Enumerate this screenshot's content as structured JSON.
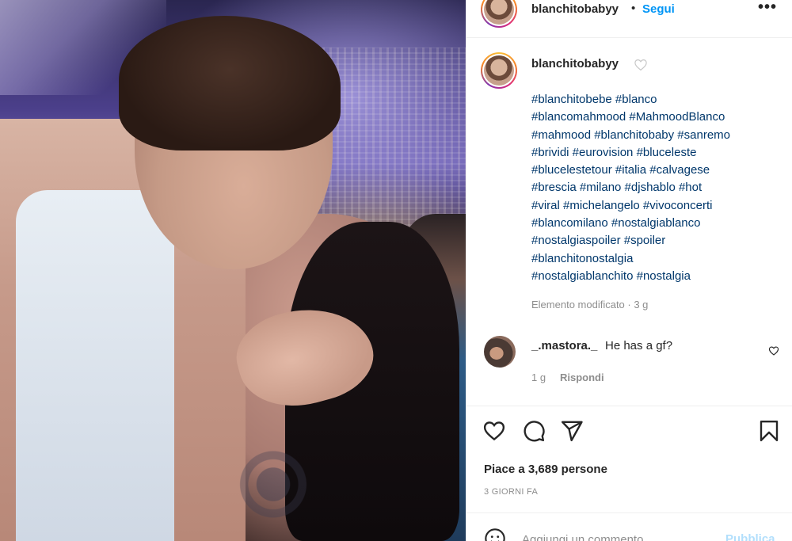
{
  "post": {
    "username": "blanchitobabyy",
    "separator": "•",
    "follow_label": "Segui",
    "more_icon": "more-horizontal-icon"
  },
  "caption": {
    "username": "blanchitobabyy",
    "hashtag_lines": [
      "#blanchitobebe #blanco",
      "#blancomahmood #MahmoodBlanco",
      "#mahmood #blanchitobaby #sanremo",
      "#brividi #eurovision #bluceleste",
      "#blucelestetour #italia #calvagese",
      "#brescia #milano #djshablo #hot",
      "#viral #michelangelo #vivoconcerti",
      "#blancomilano #nostalgiablanco",
      "#nostalgiaspoiler #spoiler",
      "#blanchitonostalgia",
      "#nostalgiablanchito #nostalgia"
    ],
    "edited": "Elemento modificato · 3 g"
  },
  "comment": {
    "username": "_.mastora._",
    "text": "He has a gf?",
    "time": "1 g",
    "reply_label": "Rispondi"
  },
  "actions": {
    "like_icon": "heart-icon",
    "comment_icon": "comment-icon",
    "share_icon": "send-icon",
    "save_icon": "bookmark-icon"
  },
  "likes": "Piace a 3,689 persone",
  "date": "3 GIORNI FA",
  "comment_bar": {
    "placeholder": "Aggiungi un commento...",
    "publish_label": "Pubblica"
  },
  "colors": {
    "link_blue": "#0095f6",
    "hashtag": "#00376b",
    "muted": "#8e8e8e",
    "publish_disabled": "#b2dffc"
  }
}
